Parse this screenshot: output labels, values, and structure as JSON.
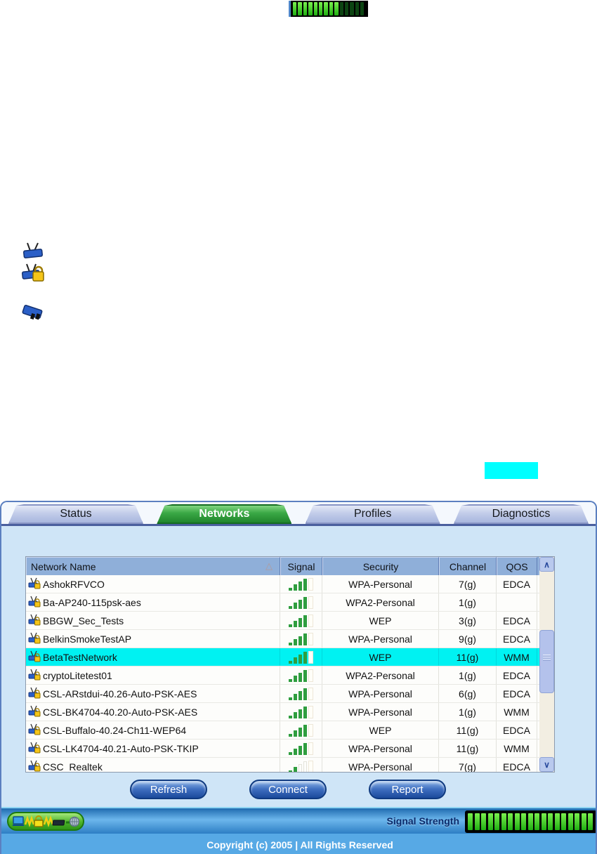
{
  "top_meter": {
    "bars_total": 14,
    "bars_lit": 9
  },
  "legend": {
    "icons": [
      "access-point-icon",
      "secured-access-point-icon",
      "wireless-adapter-icon"
    ]
  },
  "swatch": {
    "color": "#00ffff"
  },
  "tabs": [
    {
      "label": "Status",
      "active": false
    },
    {
      "label": "Networks",
      "active": true
    },
    {
      "label": "Profiles",
      "active": false
    },
    {
      "label": "Diagnostics",
      "active": false
    }
  ],
  "table": {
    "columns": [
      "Network Name",
      "Signal",
      "Security",
      "Channel",
      "QOS"
    ],
    "sort_icon": "△",
    "rows": [
      {
        "name": "AshokRFVCO",
        "signal": 4,
        "security": "WPA-Personal",
        "channel": "7(g)",
        "qos": "EDCA",
        "selected": false
      },
      {
        "name": "Ba-AP240-115psk-aes",
        "signal": 4,
        "security": "WPA2-Personal",
        "channel": "1(g)",
        "qos": "",
        "selected": false
      },
      {
        "name": "BBGW_Sec_Tests",
        "signal": 4,
        "security": "WEP",
        "channel": "3(g)",
        "qos": "EDCA",
        "selected": false
      },
      {
        "name": "BelkinSmokeTestAP",
        "signal": 4,
        "security": "WPA-Personal",
        "channel": "9(g)",
        "qos": "EDCA",
        "selected": false
      },
      {
        "name": "BetaTestNetwork",
        "signal": 4,
        "security": "WEP",
        "channel": "11(g)",
        "qos": "WMM",
        "selected": true
      },
      {
        "name": "cryptoLitetest01",
        "signal": 4,
        "security": "WPA2-Personal",
        "channel": "1(g)",
        "qos": "EDCA",
        "selected": false
      },
      {
        "name": "CSL-ARstdui-40.26-Auto-PSK-AES",
        "signal": 4,
        "security": "WPA-Personal",
        "channel": "6(g)",
        "qos": "EDCA",
        "selected": false
      },
      {
        "name": "CSL-BK4704-40.20-Auto-PSK-AES",
        "signal": 4,
        "security": "WPA-Personal",
        "channel": "1(g)",
        "qos": "WMM",
        "selected": false
      },
      {
        "name": "CSL-Buffalo-40.24-Ch11-WEP64",
        "signal": 4,
        "security": "WEP",
        "channel": "11(g)",
        "qos": "EDCA",
        "selected": false
      },
      {
        "name": "CSL-LK4704-40.21-Auto-PSK-TKIP",
        "signal": 4,
        "security": "WPA-Personal",
        "channel": "11(g)",
        "qos": "WMM",
        "selected": false
      },
      {
        "name": "CSC_Realtek",
        "signal": 2,
        "security": "WPA-Personal",
        "channel": "7(g)",
        "qos": "EDCA",
        "selected": false
      }
    ]
  },
  "buttons": [
    {
      "label": "Refresh"
    },
    {
      "label": "Connect"
    },
    {
      "label": "Report"
    }
  ],
  "footer": {
    "signal_strength_label": "Signal Strength",
    "meter": {
      "bars_total": 19,
      "bars_lit": 19
    },
    "copyright": "Copyright (c) 2005 | All Rights Reserved"
  },
  "colors": {
    "selected_row": "#00f2f2",
    "tab_active_green": "#2f9e3c",
    "tab_inactive_lavender": "#b7c3e6",
    "table_header_bg": "#8fafd9",
    "panel_bg": "#cfe5f7",
    "footer_bar_blue": "#3f8fd0",
    "copyright_bg": "#57a9e5",
    "meter_lit_green": "#2fd41e",
    "meter_unlit_green": "#0c4412",
    "button_blue": "#2a5cab",
    "signal_bar_green": "#2f9e3f"
  }
}
